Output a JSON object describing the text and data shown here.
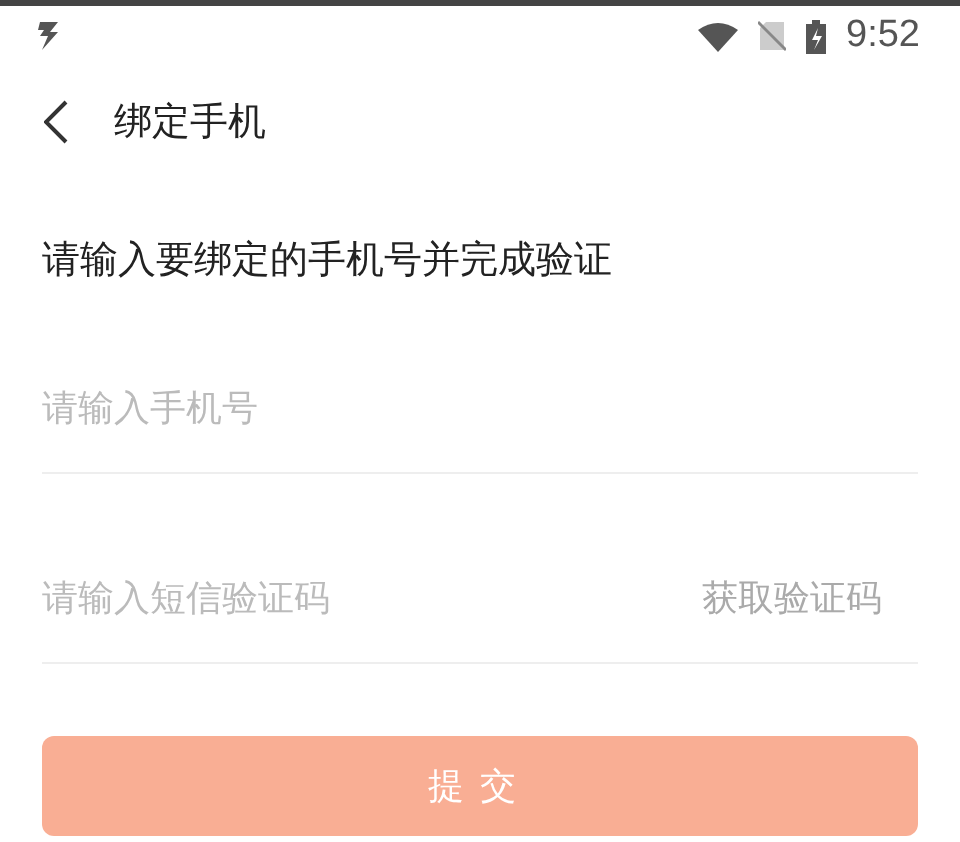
{
  "status_bar": {
    "time": "9:52"
  },
  "header": {
    "title": "绑定手机"
  },
  "instruction": "请输入要绑定的手机号并完成验证",
  "phone_field": {
    "placeholder": "请输入手机号"
  },
  "code_field": {
    "placeholder": "请输入短信验证码",
    "action": "获取验证码"
  },
  "submit_button": {
    "label": "提交",
    "disabled": true
  }
}
